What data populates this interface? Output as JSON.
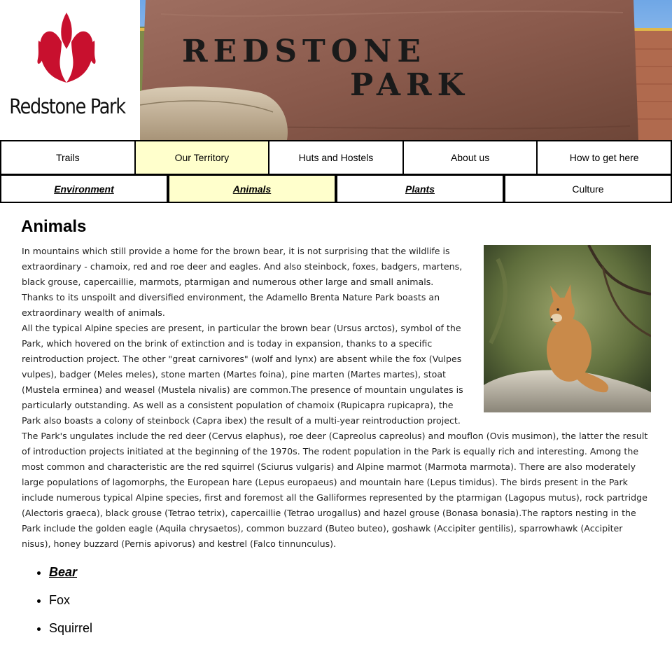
{
  "site": {
    "logo_text": "Redstone Park",
    "banner_text_line1": "REDSTONE",
    "banner_text_line2": "PARK"
  },
  "nav_primary": [
    {
      "label": "Trails",
      "active": false
    },
    {
      "label": "Our Territory",
      "active": true
    },
    {
      "label": "Huts and Hostels",
      "active": false
    },
    {
      "label": "About us",
      "active": false
    },
    {
      "label": "How to get here",
      "active": false
    }
  ],
  "nav_secondary": [
    {
      "label": "Environment",
      "active": false,
      "link": true
    },
    {
      "label": "Animals",
      "active": true,
      "link": true
    },
    {
      "label": "Plants",
      "active": false,
      "link": true
    },
    {
      "label": "Culture",
      "active": false,
      "link": false
    }
  ],
  "page": {
    "title": "Animals",
    "paragraphs": [
      "In mountains which still provide a home for the brown bear, it is not surprising that the wildlife is extraordinary - chamoix, red and roe deer and eagles.  And also steinbock, foxes, badgers, martens, black grouse, capercaillie,  marmots, ptarmigan and numerous other large and small animals.",
      "Thanks to its unspoilt and diversified environment, the Adamello Brenta Nature Park boasts an extraordinary wealth of animals.",
      "All the typical Alpine species are present, in particular the brown bear (Ursus arctos), symbol of the Park, which hovered on the brink of extinction and is today in expansion, thanks to a specific reintroduction project. The other \"great carnivores\" (wolf and lynx) are absent while the fox (Vulpes vulpes), badger (Meles meles), stone marten (Martes foina), pine marten (Martes martes), stoat (Mustela erminea) and weasel (Mustela nivalis) are common.The presence of mountain ungulates is particularly outstanding.  As well as a consistent population of chamoix (Rupicapra rupicapra), the Park also boasts a colony of steinbock (Capra ibex) the result of a multi-year reintroduction project. The Park's ungulates include the red deer (Cervus elaphus), roe deer (Capreolus capreolus) and mouflon (Ovis musimon), the latter the result of introduction projects initiated at the beginning of the 1970s. The rodent population in the Park is equally rich and interesting. Among the most common and characteristic are the red squirrel (Sciurus vulgaris) and Alpine marmot (Marmota marmota). There are also moderately large populations of lagomorphs, the European hare (Lepus europaeus) and mountain hare (Lepus timidus). The birds present in the Park include numerous typical Alpine species, first and foremost all the Galliformes represented by the ptarmigan (Lagopus mutus), rock partridge (Alectoris graeca), black grouse (Tetrao tetrix), capercaillie (Tetrao urogallus) and hazel grouse (Bonasa bonasia).The raptors nesting in the Park include the golden eagle (Aquila chrysaetos), common buzzard (Buteo buteo), goshawk (Accipiter gentilis), sparrowhawk (Accipiter nisus), honey buzzard (Pernis apivorus) and kestrel (Falco tinnunculus)."
    ],
    "animal_list": [
      {
        "label": "Bear",
        "link": true
      },
      {
        "label": "Fox",
        "link": false
      },
      {
        "label": "Squirrel",
        "link": false
      }
    ]
  },
  "colors": {
    "active_tab": "#ffffcc",
    "logo_red": "#c8102e",
    "stone": "#8a5a4c"
  }
}
